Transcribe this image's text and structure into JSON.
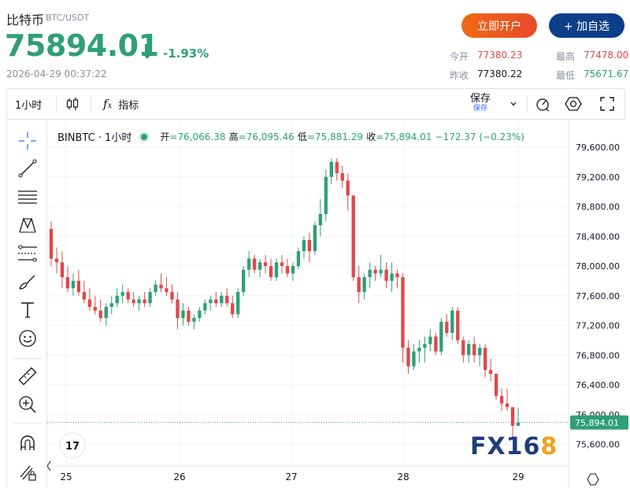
{
  "header": {
    "coin_name": "比特币",
    "pair": "BTC/USDT",
    "price": "75894.01",
    "change_pct": "-1.93%",
    "timestamp": "2026-04-29 00:37:22",
    "open_account_label": "立即开户",
    "add_watchlist_label": "+ 加自选",
    "stats": {
      "today_open_label": "今开",
      "today_open": "77380.23",
      "high_label": "最高",
      "high": "77478.00",
      "prev_close_label": "昨收",
      "prev_close": "77380.22",
      "low_label": "最低",
      "low": "75671.67"
    }
  },
  "toolbar": {
    "interval": "1小时",
    "indicators_label": "指标",
    "save_label": "保存",
    "save_sub": "保存"
  },
  "chart_legend": {
    "symbol": "BINBTC · 1小时",
    "open_label": "开",
    "open": "=76,066.38",
    "high_label": "高",
    "high": "=76,095.46",
    "low_label": "低",
    "low": "=75,881.29",
    "close_label": "收",
    "close": "=75,894.01",
    "change": "−172.37 (−0.23%)"
  },
  "colors": {
    "up": "#2e9f76",
    "down": "#e04848",
    "primary_blue": "#0d3e88",
    "orange": "#f06a16"
  },
  "chart_data": {
    "type": "candlestick",
    "interval": "1小时",
    "y_ticks": [
      "79,600.00",
      "79,200.00",
      "78,800.00",
      "78,400.00",
      "78,000.00",
      "77,600.00",
      "77,200.00",
      "76,800.00",
      "76,400.00",
      "76,000.00",
      "75,600.00"
    ],
    "y_tick_values": [
      79600,
      79200,
      78800,
      78400,
      78000,
      77600,
      77200,
      76800,
      76400,
      76000,
      75600
    ],
    "x_labels": [
      "25",
      "26",
      "27",
      "28",
      "29"
    ],
    "current_price_label": "75,894.01",
    "current_price": 75894.01,
    "ylim": [
      75300,
      79760
    ],
    "candles": [
      [
        78500,
        78600,
        78000,
        78100
      ],
      [
        78100,
        78250,
        77900,
        78050
      ],
      [
        78050,
        78200,
        77700,
        77850
      ],
      [
        77850,
        78000,
        77650,
        77700
      ],
      [
        77700,
        77900,
        77600,
        77800
      ],
      [
        77800,
        77950,
        77600,
        77650
      ],
      [
        77650,
        77800,
        77500,
        77550
      ],
      [
        77550,
        77700,
        77400,
        77450
      ],
      [
        77450,
        77600,
        77350,
        77400
      ],
      [
        77400,
        77550,
        77250,
        77300
      ],
      [
        77300,
        77500,
        77200,
        77450
      ],
      [
        77450,
        77600,
        77350,
        77500
      ],
      [
        77500,
        77700,
        77450,
        77600
      ],
      [
        77600,
        77750,
        77500,
        77650
      ],
      [
        77650,
        77700,
        77500,
        77550
      ],
      [
        77550,
        77650,
        77450,
        77500
      ],
      [
        77500,
        77600,
        77400,
        77550
      ],
      [
        77550,
        77650,
        77450,
        77500
      ],
      [
        77500,
        77700,
        77450,
        77650
      ],
      [
        77650,
        77800,
        77600,
        77750
      ],
      [
        77750,
        77900,
        77650,
        77700
      ],
      [
        77700,
        77850,
        77600,
        77650
      ],
      [
        77650,
        77750,
        77500,
        77550
      ],
      [
        77550,
        77650,
        77150,
        77300
      ],
      [
        77300,
        77500,
        77200,
        77400
      ],
      [
        77400,
        77450,
        77200,
        77250
      ],
      [
        77250,
        77350,
        77150,
        77300
      ],
      [
        77300,
        77450,
        77250,
        77400
      ],
      [
        77400,
        77550,
        77350,
        77500
      ],
      [
        77500,
        77600,
        77400,
        77550
      ],
      [
        77550,
        77650,
        77450,
        77500
      ],
      [
        77500,
        77650,
        77450,
        77600
      ],
      [
        77600,
        77700,
        77450,
        77500
      ],
      [
        77500,
        77600,
        77300,
        77350
      ],
      [
        77350,
        77700,
        77300,
        77650
      ],
      [
        77650,
        78000,
        77600,
        77950
      ],
      [
        77950,
        78200,
        77850,
        78100
      ],
      [
        78100,
        78150,
        77900,
        77950
      ],
      [
        77950,
        78100,
        77850,
        78050
      ],
      [
        78050,
        78150,
        77900,
        78000
      ],
      [
        78000,
        78100,
        77800,
        77850
      ],
      [
        77850,
        78100,
        77800,
        78050
      ],
      [
        78050,
        78150,
        77900,
        78000
      ],
      [
        78000,
        78100,
        77850,
        77900
      ],
      [
        77900,
        78050,
        77800,
        78000
      ],
      [
        78000,
        78250,
        77950,
        78200
      ],
      [
        78200,
        78400,
        78100,
        78350
      ],
      [
        78350,
        78450,
        78050,
        78200
      ],
      [
        78200,
        78600,
        78150,
        78550
      ],
      [
        78550,
        78900,
        78400,
        78700
      ],
      [
        78700,
        79300,
        78600,
        79200
      ],
      [
        79200,
        79450,
        79100,
        79400
      ],
      [
        79400,
        79450,
        79150,
        79250
      ],
      [
        79250,
        79350,
        79050,
        79150
      ],
      [
        79150,
        79250,
        78750,
        78950
      ],
      [
        78950,
        78950,
        77800,
        77850
      ],
      [
        77850,
        78000,
        77500,
        77650
      ],
      [
        77650,
        77900,
        77550,
        77850
      ],
      [
        77850,
        78050,
        77700,
        77950
      ],
      [
        77950,
        78000,
        77800,
        77900
      ],
      [
        77900,
        78150,
        77850,
        77950
      ],
      [
        77950,
        78050,
        77700,
        77800
      ],
      [
        77800,
        78050,
        77650,
        77900
      ],
      [
        77900,
        77950,
        77700,
        77850
      ],
      [
        77850,
        77900,
        76700,
        76900
      ],
      [
        76900,
        77000,
        76550,
        76650
      ],
      [
        76650,
        76950,
        76600,
        76850
      ],
      [
        76850,
        77000,
        76700,
        76900
      ],
      [
        76900,
        77050,
        76700,
        76950
      ],
      [
        76950,
        77150,
        76850,
        77050
      ],
      [
        77050,
        77100,
        76800,
        76850
      ],
      [
        76850,
        77300,
        76800,
        77250
      ],
      [
        77250,
        77350,
        77050,
        77100
      ],
      [
        77100,
        77450,
        77000,
        77400
      ],
      [
        77400,
        77450,
        76950,
        77000
      ],
      [
        77000,
        77050,
        76700,
        76800
      ],
      [
        76800,
        77000,
        76700,
        76950
      ],
      [
        76950,
        77050,
        76700,
        76800
      ],
      [
        76800,
        76950,
        76650,
        76900
      ],
      [
        76900,
        76950,
        76500,
        76600
      ],
      [
        76600,
        76750,
        76450,
        76550
      ],
      [
        76550,
        76550,
        76200,
        76250
      ],
      [
        76250,
        76350,
        76050,
        76150
      ],
      [
        76150,
        76350,
        76050,
        76100
      ],
      [
        76100,
        76100,
        75700,
        75850
      ],
      [
        75850,
        76095,
        75881,
        75894
      ]
    ]
  },
  "watermark": "FX168"
}
